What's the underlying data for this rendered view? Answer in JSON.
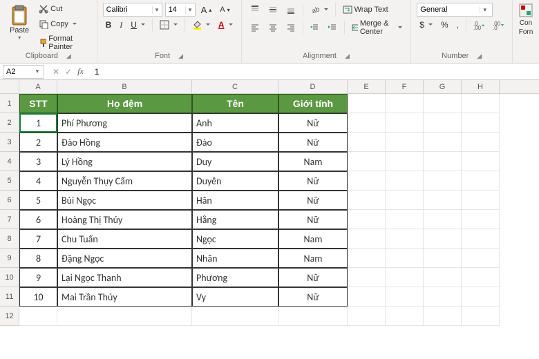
{
  "ribbon": {
    "clipboard": {
      "paste": "Paste",
      "cut": "Cut",
      "copy": "Copy",
      "format_painter": "Format Painter",
      "group": "Clipboard"
    },
    "font": {
      "name": "Calibri",
      "size": "14",
      "bold": "B",
      "italic": "I",
      "underline": "U",
      "group": "Font",
      "increase": "A",
      "decrease": "A"
    },
    "alignment": {
      "wrap": "Wrap Text",
      "merge": "Merge & Center",
      "group": "Alignment"
    },
    "number": {
      "format": "General",
      "currency": "$",
      "percent": "%",
      "comma": ",",
      "group": "Number"
    },
    "styles": {
      "cond": "Con",
      "cond2": "Forn"
    }
  },
  "formula": {
    "namebox": "A2",
    "value": "1"
  },
  "columns": [
    "A",
    "B",
    "C",
    "D",
    "E",
    "F",
    "G",
    "H"
  ],
  "header_row": {
    "stt": "STT",
    "hodem": "Họ đệm",
    "ten": "Tên",
    "gioitinh": "Giới tính"
  },
  "rows": [
    {
      "n": "1",
      "stt": "1",
      "hodem": "Phí Phương",
      "ten": "Anh",
      "gt": "Nữ"
    },
    {
      "n": "2",
      "stt": "2",
      "hodem": "Đào Hồng",
      "ten": "Đào",
      "gt": "Nữ"
    },
    {
      "n": "3",
      "stt": "3",
      "hodem": "Lý Hồng",
      "ten": "Duy",
      "gt": "Nam"
    },
    {
      "n": "4",
      "stt": "4",
      "hodem": "Nguyễn Thụy Cẩm",
      "ten": "Duyên",
      "gt": "Nữ"
    },
    {
      "n": "5",
      "stt": "5",
      "hodem": "Bùi Ngọc",
      "ten": "Hân",
      "gt": "Nữ"
    },
    {
      "n": "6",
      "stt": "6",
      "hodem": "Hoàng Thị Thúy",
      "ten": "Hằng",
      "gt": "Nữ"
    },
    {
      "n": "7",
      "stt": "7",
      "hodem": "Chu Tuấn",
      "ten": "Ngọc",
      "gt": "Nam"
    },
    {
      "n": "8",
      "stt": "8",
      "hodem": "Đặng Ngọc",
      "ten": "Nhân",
      "gt": "Nam"
    },
    {
      "n": "9",
      "stt": "9",
      "hodem": "Lại Ngọc Thanh",
      "ten": "Phương",
      "gt": "Nữ"
    },
    {
      "n": "10",
      "stt": "10",
      "hodem": "Mai Trần Thúy",
      "ten": "Vy",
      "gt": "Nữ"
    }
  ],
  "extra_rows": [
    "11",
    "12"
  ]
}
